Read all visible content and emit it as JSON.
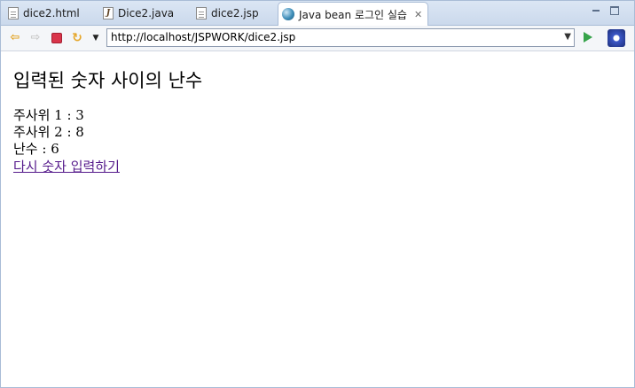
{
  "tabs": [
    {
      "label": "dice2.html",
      "icon": "html-file-icon"
    },
    {
      "label": "Dice2.java",
      "icon": "java-file-icon"
    },
    {
      "label": "dice2.jsp",
      "icon": "jsp-file-icon"
    },
    {
      "label": "Java bean 로그인 실습",
      "icon": "globe-icon",
      "active": true
    }
  ],
  "toolbar": {
    "url": "http://localhost/JSPWORK/dice2.jsp"
  },
  "page": {
    "heading": "입력된 숫자 사이의 난수",
    "dice1": "주사위 1 : 3",
    "dice2": "주사위 2 : 8",
    "random": "난수 : 6",
    "link": "다시 숫자 입력하기"
  },
  "colors": {
    "link_visited": "#551a8b",
    "tab_bar": "#cbd9ec"
  }
}
